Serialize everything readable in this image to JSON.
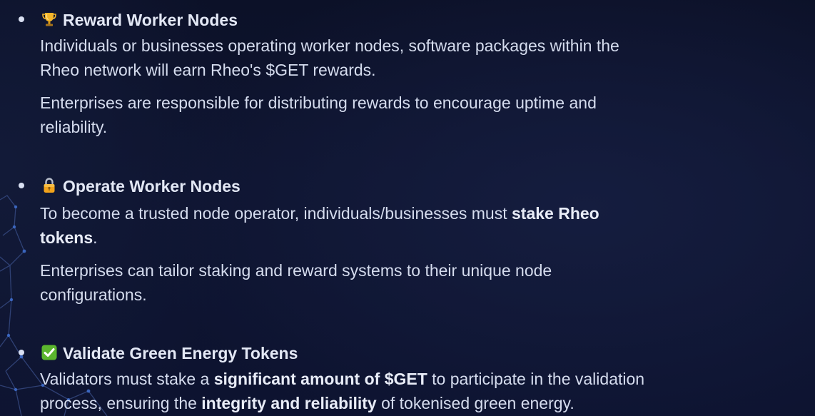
{
  "items": [
    {
      "icon": "trophy-icon",
      "title": "Reward Worker Nodes",
      "lines": [
        {
          "text": "Individuals or businesses operating worker nodes, software packages within the"
        },
        {
          "text": "Rheo network will earn Rheo's $GET rewards."
        },
        {
          "text": "Enterprises are responsible for distributing rewards to encourage uptime and"
        },
        {
          "text": "reliability."
        }
      ]
    },
    {
      "icon": "lock-icon",
      "title": "Operate Worker Nodes",
      "lines": [
        {
          "pre": "To become a trusted node operator, individuals/businesses must ",
          "bold": "stake Rheo"
        },
        {
          "bold": "tokens",
          "post": "."
        },
        {
          "text": "Enterprises can tailor staking and reward systems to their unique node"
        },
        {
          "text": "configurations."
        }
      ]
    },
    {
      "icon": "check-mark-icon",
      "title": "Validate Green Energy Tokens",
      "lines": [
        {
          "pre": "Validators must stake a ",
          "bold": "significant amount of $GET",
          "post": " to participate in the validation"
        },
        {
          "pre": "process, ensuring the ",
          "bold": "integrity and reliability",
          "post": " of tokenised green energy."
        }
      ]
    }
  ],
  "colors": {
    "background": "#0e1430",
    "text": "#d5dcee",
    "check_green": "#5bb62e",
    "lock_gold": "#f2a31b",
    "trophy_gold": "#f4b52a"
  }
}
